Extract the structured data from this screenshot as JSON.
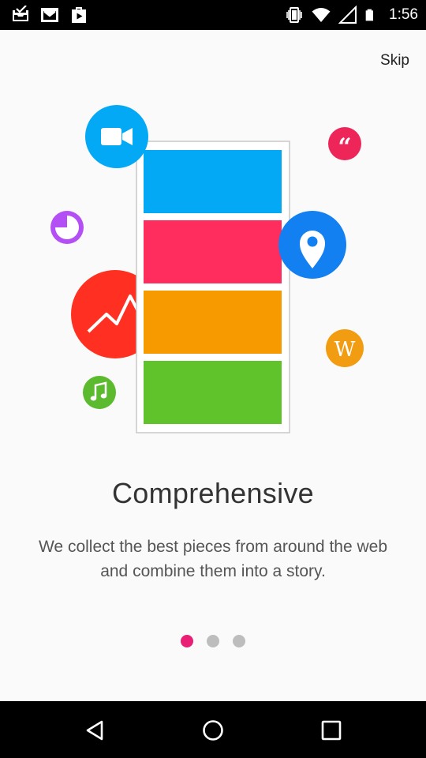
{
  "status_bar": {
    "left_icons": [
      "inbox-check-icon",
      "gmail-icon",
      "play-store-icon"
    ],
    "right_icons": [
      "vibrate-icon",
      "wifi-icon",
      "signal-icon",
      "battery-icon"
    ],
    "time": "1:56"
  },
  "onboarding": {
    "skip_label": "Skip",
    "title": "Comprehensive",
    "description": "We collect the best pieces from around the web and combine them into a story.",
    "pages_total": 3,
    "current_page": 1
  },
  "illustration": {
    "phone_blocks": [
      "#03a9f4",
      "#ff2d5d",
      "#f79a00",
      "#61c32b"
    ],
    "icons": [
      {
        "name": "video-camera-icon",
        "color": "#03a9f4"
      },
      {
        "name": "quote-icon",
        "color": "#ee2558"
      },
      {
        "name": "pie-chart-icon",
        "color": "#b44ff5"
      },
      {
        "name": "location-pin-icon",
        "color": "#1380f2"
      },
      {
        "name": "line-chart-icon",
        "color": "#ff3021"
      },
      {
        "name": "wikipedia-icon",
        "color": "#f29c12"
      },
      {
        "name": "music-note-icon",
        "color": "#5cba2e"
      }
    ],
    "wikipedia_letter": "W"
  },
  "nav_bar": {
    "buttons": [
      "back-icon",
      "home-icon",
      "recents-icon"
    ]
  }
}
